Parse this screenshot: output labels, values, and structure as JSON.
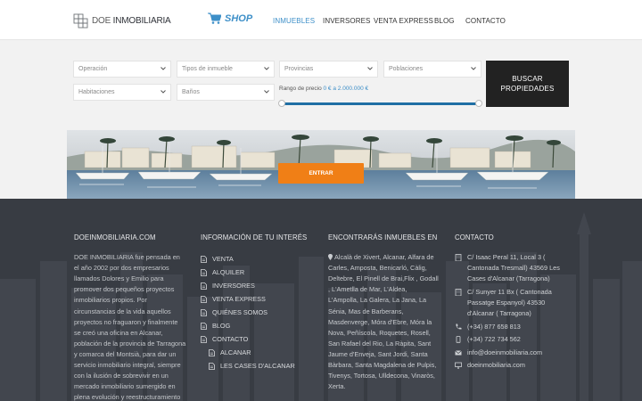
{
  "header": {
    "logo_prefix": "DOE",
    "logo_name": "INMOBILIARIA",
    "shop_label": "SHOP",
    "nav": [
      "INMUEBLES",
      "INVERSORES",
      "VENTA EXPRESS",
      "BLOG",
      "CONTACTO"
    ],
    "active_nav": "INMUEBLES"
  },
  "search": {
    "operacion": "Operación",
    "tipos": "Tipos de inmueble",
    "provincias": "Provincias",
    "poblaciones": "Poblaciones",
    "habitaciones": "Habitaciones",
    "banos": "Baños",
    "price_label": "Rango de precio",
    "price_range": "0 € a 2.000.000 €",
    "button_label": "BUSCAR PROPIEDADES"
  },
  "banner": {
    "enter_label": "ENTRAR"
  },
  "footer": {
    "about": {
      "heading": "DOEINMOBILIARIA.COM",
      "text": "DOE INMOBILIARIA fue pensada en el año 2002 por dos empresarios llamados Dolores y Emilio para promover dos pequeños proyectos inmobiliarios propios. Por circunstancias de la vida aquellos proyectos no fraguaron y finalmente se creó una oficina en Alcanar, población de la provincia de Tarragona y comarca del Montsià, para dar un servicio inmobiliario integral, siempre con la ilusión de sobrevivir en un mercado inmobiliario sumergido en plena evolución y reestructuramiento después de vivir el fenómeno"
    },
    "info": {
      "heading": "INFORMACIÓN DE TU INTERÉS",
      "items": [
        "VENTA",
        "ALQUILER",
        "INVERSORES",
        "VENTA EXPRESS",
        "QUIÉNES SOMOS",
        "BLOG",
        "CONTACTO"
      ],
      "subitems": [
        "ALCANAR",
        "LES CASES D'ALCANAR"
      ]
    },
    "towns": {
      "heading": "ENCONTRARÁS INMUEBLES EN",
      "text": "Alcalà de Xivert, Alcanar, Alfara de Carles, Amposta, Benicarló, Càlig, Deltebre, El Pinell de Brai,Flix , Godall , L'Ametlla de Mar, L'Aldea, L'Ampolla, La Galera, La Jana, La Sénia, Mas de Barberans, Masdenverge, Móra d'Ebre, Móra la Nova, Peñíscola, Roquetes, Rosell, San Rafael del Rio, La Ràpita, Sant Jaume d'Enveja, Sant Jordi, Santa Bàrbara, Santa Magdalena de Pulpis, Tivenys, Tortosa, Ulldecona, Vinaròs, Xerta."
    },
    "contact": {
      "heading": "CONTACTO",
      "address1": "C/ Isaac Peral 11, Local 3 ( Cantonada Tresmall) 43569 Les Cases d'Alcanar (Tarragona)",
      "address2": "C/ Sunyer 11 Bx ( Cantonada Passatge Espanyol) 43530 d'Alcanar ( Tarragona)",
      "phone1": "(+34) 877 658 813",
      "phone2": "(+34) 722 734 562",
      "email": "info@doeinmobiliaria.com",
      "web": "doeinmobiliaria.com"
    }
  },
  "colors": {
    "accent": "#3d8fc8",
    "button_dark": "#222222",
    "enter_orange": "#f07f16",
    "footer_bg": "#383c43"
  }
}
